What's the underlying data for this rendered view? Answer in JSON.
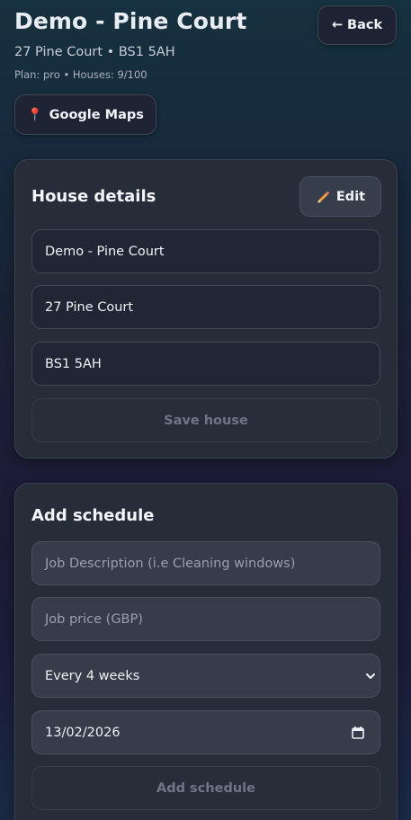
{
  "header": {
    "title": "Demo - Pine Court",
    "subtitle": "27 Pine Court • BS1 5AH",
    "meta": "Plan: pro • Houses: 9/100",
    "back_label": "← Back",
    "maps_label": "Google Maps",
    "maps_icon": "📍"
  },
  "house_details": {
    "title": "House details",
    "edit_label": "Edit",
    "edit_icon": "pencil-icon",
    "name_value": "Demo - Pine Court",
    "street_value": "27 Pine Court",
    "postcode_value": "BS1 5AH",
    "save_label": "Save house"
  },
  "add_schedule": {
    "title": "Add schedule",
    "description_placeholder": "Job Description (i.e Cleaning windows)",
    "price_placeholder": "Job price (GBP)",
    "frequency_value": "Every 4 weeks",
    "date_value": "13/02/2026",
    "submit_label": "Add schedule"
  }
}
